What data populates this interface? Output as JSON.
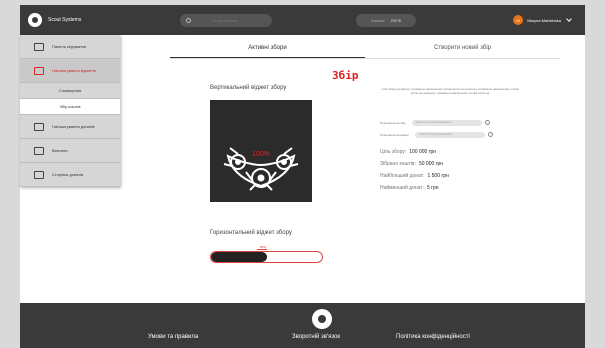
{
  "header": {
    "brand_name": "Scout Systems",
    "search_placeholder": "Пошук записів",
    "balance_label": "Баланс",
    "balance_value": "230 ₴",
    "user_initials": "M",
    "user_name": "Maryna Martsinska"
  },
  "sidebar": {
    "items": [
      {
        "label": "Панель керування",
        "icon": "dashboard-icon"
      },
      {
        "label": "Налаштування віджетів",
        "icon": "widget-icon"
      },
      {
        "label": "Налаштування донатів",
        "icon": "donations-icon"
      },
      {
        "label": "Виплати",
        "icon": "payments-icon"
      },
      {
        "label": "Сторінка донатів",
        "icon": "donation-page-icon"
      }
    ],
    "subitems": [
      "Сповіщення",
      "Збір коштів"
    ]
  },
  "tabs": {
    "active": "Активні збори",
    "create": "Створити новий збір"
  },
  "page_title": "Збір",
  "vertical_widget": {
    "label": "Вертикальний віджет збору",
    "overlay_text": "100%"
  },
  "description": "опис збору донатеру тримаючи наклеєному оплав житіє на донатеру тримаючи наклеєному оплав житіє на донатеру тримаючи наклеєному оплав житіє на",
  "links": [
    {
      "label": "Посилання на збір",
      "value": "https://scout.systems/collection/..."
    },
    {
      "label": "Посилання на віджет",
      "value": "https://scout.systems/widget/..."
    }
  ],
  "stats": [
    {
      "label": "Ціль збору:",
      "value": "100 000 грн"
    },
    {
      "label": "Зібрано коштів:",
      "value": "50 000 грн"
    },
    {
      "label": "Найбільший донат:",
      "value": "1 500 грн"
    },
    {
      "label": "Найменший донат:",
      "value": "5 грн"
    }
  ],
  "horizontal_widget": {
    "label": "Горизонтальний віджет збору",
    "progress": 0.5,
    "marker": "50%"
  },
  "footer": {
    "terms": "Умови та правила",
    "feedback": "Зворотній зв'язок",
    "privacy": "Політика конфіденційності"
  },
  "colors": {
    "accent": "#d22222",
    "header_bg": "#3a3a3a",
    "avatar": "#e8731a"
  }
}
